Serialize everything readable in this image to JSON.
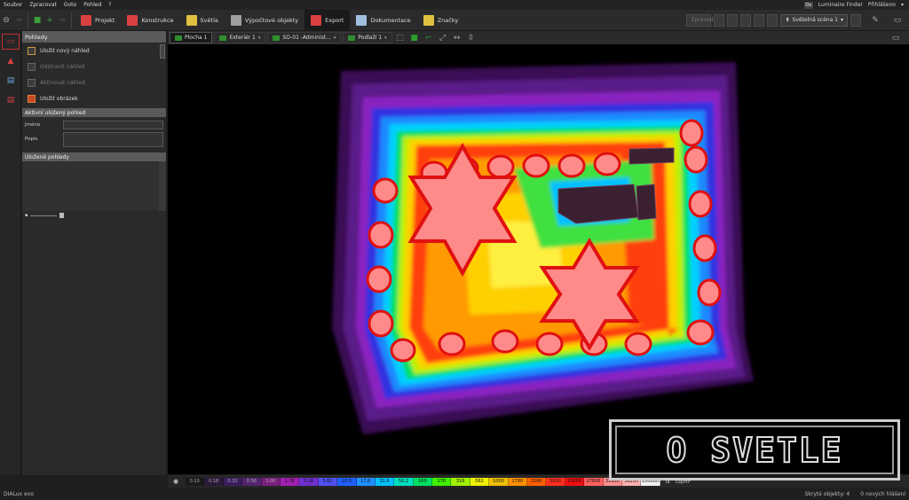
{
  "menu": {
    "items": [
      "Soubor",
      "Zpracovat",
      "Goto",
      "Pohled",
      "?"
    ],
    "luminaire_finder": "Luminaire Finder",
    "login": "Přihlášeno"
  },
  "toolbar": {
    "modes": [
      {
        "label": "Projekt",
        "icon": "project-icon",
        "color": "#d94040"
      },
      {
        "label": "Konstrukce",
        "icon": "construction-icon",
        "color": "#d94040"
      },
      {
        "label": "Světla",
        "icon": "light-icon",
        "color": "#e0c040"
      },
      {
        "label": "Výpočtové objekty",
        "icon": "calc-objects-icon",
        "color": "#a0a0a0"
      },
      {
        "label": "Export",
        "icon": "export-icon",
        "color": "#d94040"
      },
      {
        "label": "Dokumentace",
        "icon": "documentation-icon",
        "color": "#a0c0e0"
      },
      {
        "label": "Značky",
        "icon": "marks-icon",
        "color": "#e0c040"
      }
    ],
    "disabled_box": "Zpravodaj",
    "scene_label": "Světelná scéna 1"
  },
  "left_panel": {
    "title": "Pohledy",
    "actions": [
      {
        "label": "Uložit nový náhled",
        "enabled": true
      },
      {
        "label": "Odstranit náhled",
        "enabled": false
      },
      {
        "label": "Aktivovat náhled",
        "enabled": false
      },
      {
        "label": "Uložit obrázek",
        "enabled": true
      }
    ],
    "active_section_title": "Aktivní uložený pohled",
    "name_label": "Jméno",
    "desc_label": "Popis",
    "saved_section_title": "Uložené pohledy"
  },
  "view_tabs": [
    {
      "label": "Plocha 1",
      "active": true
    },
    {
      "label": "Exteriér 1",
      "active": false
    },
    {
      "label": "SO-01 -Administ...",
      "active": false
    },
    {
      "label": "Podlaží 1",
      "active": false
    }
  ],
  "legend": {
    "values": [
      "0.10",
      "0.18",
      "0.32",
      "0.56",
      "1.00",
      "1.78",
      "3.16",
      "5.62",
      "10.0",
      "17.8",
      "31.6",
      "56.2",
      "100",
      "178",
      "316",
      "562",
      "1000",
      "1780",
      "3160",
      "5620",
      "10000",
      "17800",
      "31600",
      "56200",
      "100000"
    ],
    "colors": [
      "#1a1a1a",
      "#2a1b3a",
      "#3a1f5e",
      "#53246f",
      "#7a1f80",
      "#a020b0",
      "#7030d0",
      "#5050f0",
      "#2060ff",
      "#2090ff",
      "#00c0ff",
      "#00e0c0",
      "#00e060",
      "#40f000",
      "#a0f000",
      "#f0f000",
      "#f0c000",
      "#ff9000",
      "#ff6000",
      "#ff3020",
      "#f01010",
      "#ff6060",
      "#ff9090",
      "#ffb0b0",
      "#f0f0f0"
    ],
    "units": [
      "lx",
      "cd/m²"
    ]
  },
  "status": {
    "app_name": "DIALux evo",
    "hidden_objects": "Skryté objekty: 4",
    "messages": "0 nových hlášení"
  },
  "watermark": "O SVETLE"
}
